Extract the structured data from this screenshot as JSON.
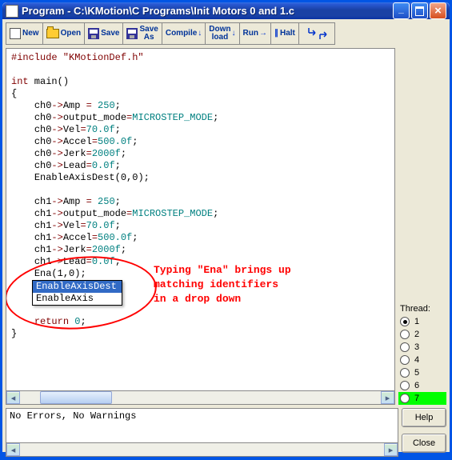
{
  "window": {
    "title": "Program - C:\\KMotion\\C Programs\\Init Motors 0 and 1.c"
  },
  "toolbar": {
    "new": "New",
    "open": "Open",
    "save": "Save",
    "save_as_l1": "Save",
    "save_as_l2": "As",
    "compile": "Compile",
    "download_l1": "Down",
    "download_l2": "load",
    "run": "Run",
    "halt": "Halt"
  },
  "code": {
    "lines": [
      {
        "t": "pre",
        "text": "#include \"KMotionDef.h\""
      },
      {
        "t": "blank",
        "text": ""
      },
      {
        "t": "sig",
        "kw": "int",
        "rest": " main()"
      },
      {
        "t": "brace",
        "text": "{"
      },
      {
        "t": "stmt",
        "obj": "ch0",
        "mem": "Amp",
        "op": " = ",
        "val": "250",
        "suf": ";"
      },
      {
        "t": "stmt",
        "obj": "ch0",
        "mem": "output_mode",
        "op": "=",
        "val": "MICROSTEP_MODE",
        "suf": ";"
      },
      {
        "t": "stmt",
        "obj": "ch0",
        "mem": "Vel",
        "op": "=",
        "val": "70.0f",
        "suf": ";"
      },
      {
        "t": "stmt",
        "obj": "ch0",
        "mem": "Accel",
        "op": "=",
        "val": "500.0f",
        "suf": ";"
      },
      {
        "t": "stmt",
        "obj": "ch0",
        "mem": "Jerk",
        "op": "=",
        "val": "2000f",
        "suf": ";"
      },
      {
        "t": "stmt",
        "obj": "ch0",
        "mem": "Lead",
        "op": "=",
        "val": "0.0f",
        "suf": ";"
      },
      {
        "t": "call",
        "fn": "EnableAxisDest",
        "args": "(0,0)",
        "suf": ";"
      },
      {
        "t": "blank",
        "text": ""
      },
      {
        "t": "stmt",
        "obj": "ch1",
        "mem": "Amp",
        "op": " = ",
        "val": "250",
        "suf": ";"
      },
      {
        "t": "stmt",
        "obj": "ch1",
        "mem": "output_mode",
        "op": "=",
        "val": "MICROSTEP_MODE",
        "suf": ";"
      },
      {
        "t": "stmt",
        "obj": "ch1",
        "mem": "Vel",
        "op": "=",
        "val": "70.0f",
        "suf": ";"
      },
      {
        "t": "stmt",
        "obj": "ch1",
        "mem": "Accel",
        "op": "=",
        "val": "500.0f",
        "suf": ";"
      },
      {
        "t": "stmt",
        "obj": "ch1",
        "mem": "Jerk",
        "op": "=",
        "val": "2000f",
        "suf": ";"
      },
      {
        "t": "stmt",
        "obj": "ch1",
        "mem": "Lead",
        "op": "=",
        "val": "0.0f",
        "suf": ";"
      },
      {
        "t": "call",
        "fn": "Ena",
        "args": "(1,0)",
        "suf": ";"
      },
      {
        "t": "ac"
      },
      {
        "t": "ac2"
      },
      {
        "t": "blank",
        "text": ""
      },
      {
        "t": "ret",
        "kw": "return",
        "val": " 0",
        "suf": ";"
      },
      {
        "t": "brace",
        "text": "}"
      }
    ],
    "autocomplete": {
      "items": [
        "EnableAxisDest",
        "EnableAxis"
      ],
      "selected": 0
    }
  },
  "annotation": {
    "line1": "Typing \"Ena\" brings up",
    "line2": "matching identifiers",
    "line3": "in a drop down"
  },
  "threads": {
    "label": "Thread:",
    "items": [
      "1",
      "2",
      "3",
      "4",
      "5",
      "6",
      "7"
    ],
    "selected": 0,
    "active_running": 6
  },
  "output": {
    "text": "No Errors, No Warnings"
  },
  "side_buttons": {
    "help": "Help",
    "close": "Close"
  }
}
